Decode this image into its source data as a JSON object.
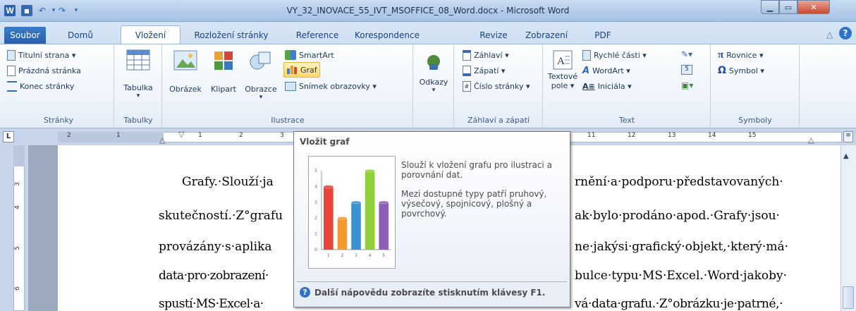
{
  "window": {
    "title": "VY_32_INOVACE_55_IVT_MSOFFICE_08_Word.docx - Microsoft Word",
    "app_icon": "W"
  },
  "tabs": [
    "Soubor",
    "Domů",
    "Vložení",
    "Rozložení stránky",
    "Reference",
    "Korespondence",
    "Revize",
    "Zobrazení",
    "PDF"
  ],
  "ribbon": {
    "stranky": {
      "label": "Stránky",
      "items": [
        "Titulní strana ▾",
        "Prázdná stránka",
        "Konec stránky"
      ]
    },
    "tabulky": {
      "label": "Tabulky",
      "button": "Tabulka"
    },
    "ilustrace": {
      "label": "Ilustrace",
      "obrazek": "Obrázek",
      "klipart": "Klipart",
      "obrazce": "Obrazce",
      "smartart": "SmartArt",
      "graf": "Graf",
      "snimek": "Snímek obrazovky ▾"
    },
    "odkazy": {
      "label": "",
      "button": "Odkazy"
    },
    "zahlavi": {
      "label": "Záhlaví a zápatí",
      "items": [
        "Záhlaví ▾",
        "Zápatí ▾",
        "Číslo stránky ▾"
      ]
    },
    "text": {
      "label": "Text",
      "textove_pole_1": "Textové",
      "textove_pole_2": "pole ▾",
      "rychle_casti": "Rychlé části ▾",
      "wordart": "WordArt ▾",
      "iniciala": "Iniciála ▾"
    },
    "symboly": {
      "label": "Symboly",
      "rovnice": "Rovnice ▾",
      "symbol": "Symbol ▾"
    }
  },
  "ruler": {
    "left_numbers": [
      "2",
      "1"
    ],
    "numbers": [
      "1",
      "2",
      "3",
      "11",
      "12",
      "13",
      "14",
      "15"
    ]
  },
  "vruler_numbers": [
    "3",
    "4",
    "5",
    "6"
  ],
  "document": {
    "lines": [
      {
        "left": "Grafy.·Slouží·ja",
        "right": "rnění·a·podporu·představovaných·"
      },
      {
        "left": "skutečností.·Z°grafu",
        "right": "ak·bylo·prodáno·apod.·Grafy·jsou·"
      },
      {
        "left": "provázány·s·aplika",
        "right": "ne·jakýsi·grafický·objekt,·který·má·"
      },
      {
        "left": "data·pro·zobrazení·",
        "right": "bulce·typu·MS·Excel.·Word·jakoby·"
      },
      {
        "left": "spustí·MS·Excel·a·",
        "right": "vá·data·grafu.·Z°obrázku·je·patrné,·"
      }
    ]
  },
  "tooltip": {
    "title": "Vložit graf",
    "desc1": "Slouží k vložení grafu pro ilustraci a porovnání dat.",
    "desc2": "Mezi dostupné typy patří pruhový, výsečový, spojnicový, plošný a povrchový.",
    "help": "Další nápovědu zobrazíte stisknutím klávesy F1.",
    "preview_chart": {
      "categories": [
        "1",
        "2",
        "3",
        "4",
        "5"
      ],
      "values": [
        4,
        2,
        3,
        5,
        3
      ],
      "y_ticks": [
        "0",
        "1",
        "2",
        "3",
        "4",
        "5"
      ],
      "colors": [
        "#e8443a",
        "#f39a2b",
        "#3a92d0",
        "#8fcf3c",
        "#8e5fb9"
      ]
    }
  }
}
